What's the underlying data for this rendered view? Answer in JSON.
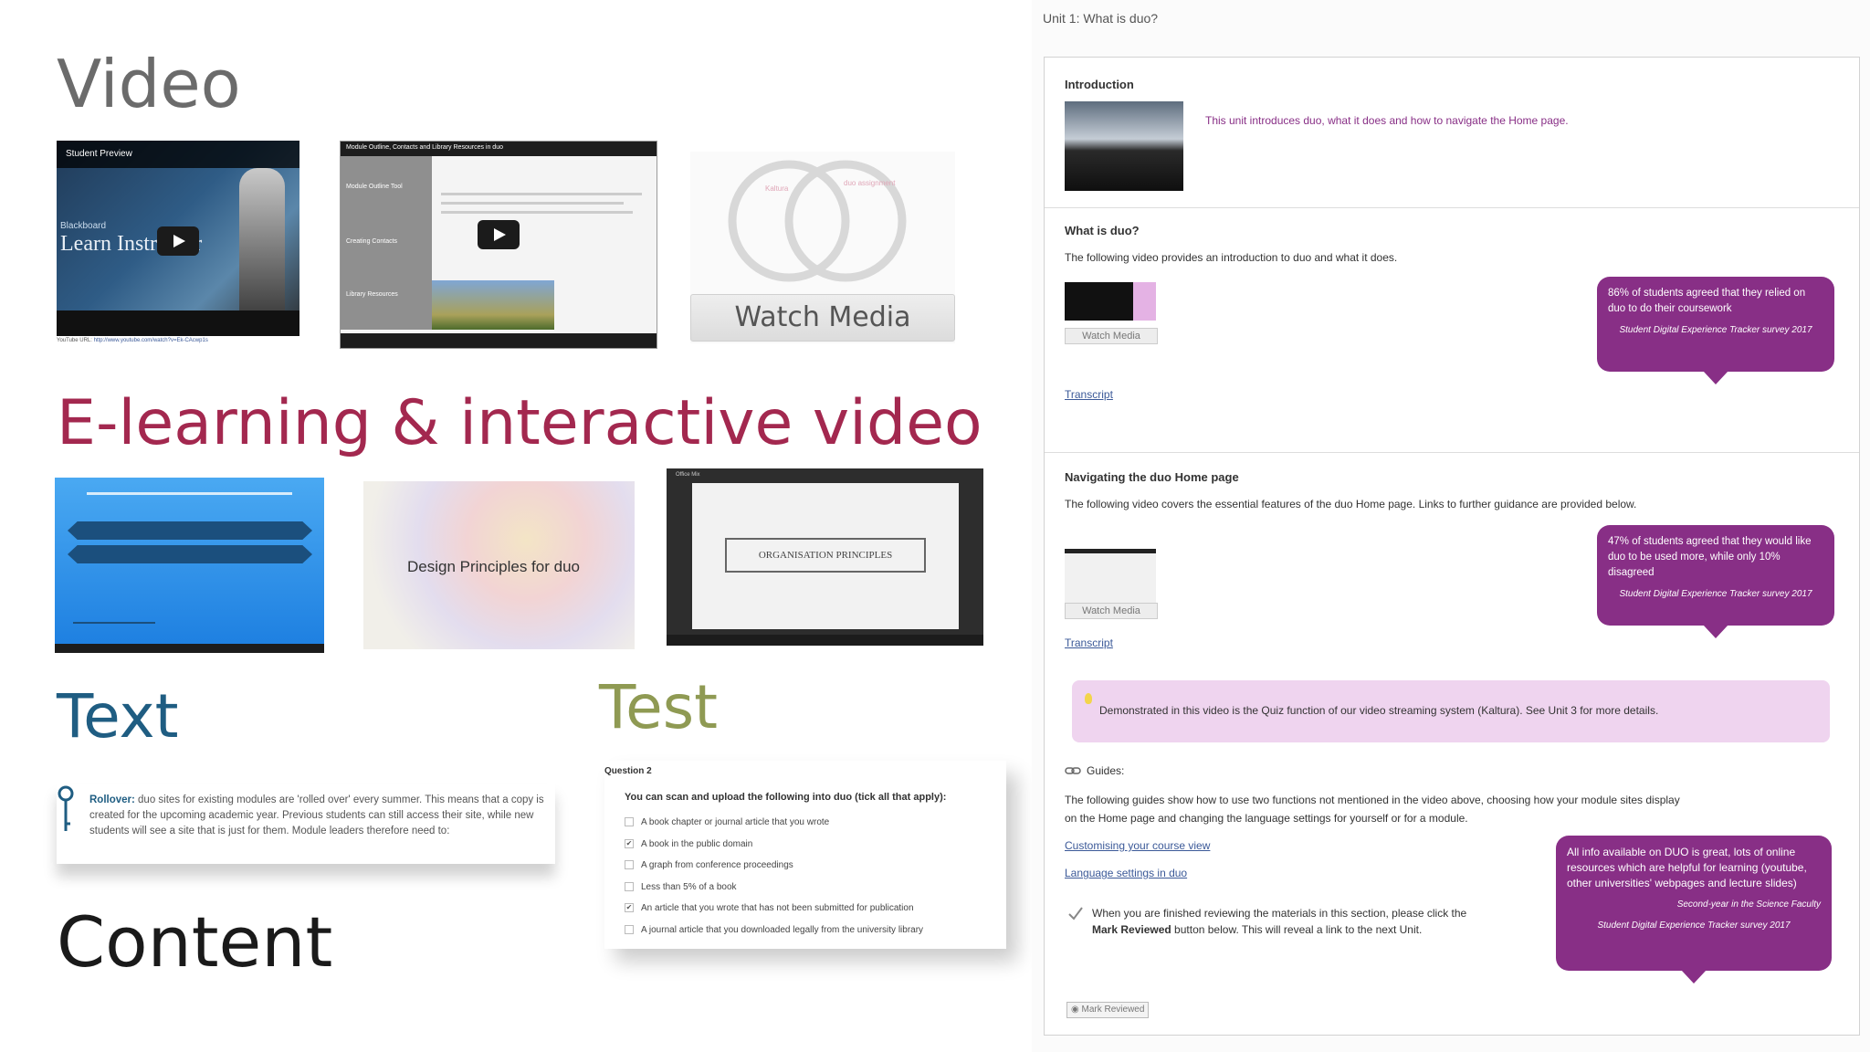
{
  "left": {
    "video_heading": "Video",
    "video_thumbs": {
      "student_preview": "Student Preview",
      "blackboard": "Blackboard",
      "learn_instructor": "Learn Instructor",
      "youtube_url_label": "YouTube URL:",
      "youtube_url": "http://www.youtube.com/watch?v=Ek-CAcwp1s",
      "module_tour_title": "Module Outline, Contacts and Library Resources in duo",
      "module_outline_tool": "Module Outline Tool",
      "creating_contacts": "Creating Contacts",
      "library_resources": "Library Resources",
      "watch_media": "Watch Media",
      "venn_left": "Kaltura",
      "venn_right": "duo assignment"
    },
    "elearning_heading": "E-learning & interactive video",
    "elearning_thumbs": {
      "design_principles": "Design Principles for duo",
      "organisation_principles": "ORGANISATION PRINCIPLES",
      "office_mix": "Office Mix"
    },
    "text_heading": "Text",
    "rollover_label": "Rollover:",
    "rollover_text": " duo sites for existing modules are 'rolled over' every summer. This means that a copy is created for the upcoming academic year. Previous students can still access their site, while new students will see a site that is just for them. Module leaders therefore need to:",
    "test_heading": "Test",
    "question": {
      "number": "Question 2",
      "prompt": "You can scan and upload the following into duo (tick all that apply):",
      "options": [
        {
          "text": "A book chapter or journal article that you wrote",
          "checked": false
        },
        {
          "text": "A book in the public domain",
          "checked": true
        },
        {
          "text": "A graph from conference proceedings",
          "checked": false
        },
        {
          "text": "Less than 5% of a book",
          "checked": false
        },
        {
          "text": "An article that you wrote that has not been submitted for publication",
          "checked": true
        },
        {
          "text": "A journal article that you downloaded legally from the university library",
          "checked": false
        }
      ]
    },
    "content_heading": "Content"
  },
  "right": {
    "unit_title": "Unit 1: What is duo?",
    "intro": {
      "title": "Introduction",
      "text": "This unit introduces duo, what it does and how to navigate the Home page."
    },
    "what_is_duo": {
      "title": "What is duo?",
      "text": "The following video provides an introduction to duo and what it does.",
      "watch": "Watch Media",
      "transcript": "Transcript",
      "bubble_text": "86% of students agreed that they relied on duo to do their coursework",
      "bubble_source": "Student Digital Experience Tracker survey 2017"
    },
    "navigating": {
      "title": "Navigating the duo Home page",
      "text": "The following video covers the essential features of the duo Home page. Links to further guidance are provided below.",
      "watch": "Watch Media",
      "transcript": "Transcript",
      "bubble_text": "47% of students agreed that they would like duo to be used more, while only 10% disagreed",
      "bubble_source": "Student Digital Experience Tracker survey 2017"
    },
    "note": "Demonstrated in this video is the Quiz function of our video streaming system (Kaltura). See Unit 3 for more details.",
    "guides": {
      "label": "Guides:",
      "text1": "The following guides show how to use two functions not mentioned in the video above, choosing how your module sites display",
      "text2": "on the Home page and changing the language settings for yourself or for a module.",
      "link1": "Customising your course view",
      "link2": "Language settings in duo"
    },
    "finish": {
      "line1": "When you are finished reviewing the materials in this section, please click the",
      "bold": "Mark Reviewed",
      "line2": " button below. This will reveal a link to the next Unit."
    },
    "bubble3": {
      "text": "All info available on DUO is great, lots of online resources which are helpful for learning (youtube, other universities' webpages and lecture slides)",
      "who": "Second-year in the Science Faculty",
      "source": "Student Digital Experience Tracker survey 2017"
    },
    "mark_reviewed": "Mark Reviewed"
  },
  "colors": {
    "video": "#6b6b6b",
    "elearning": "#a3284f",
    "text": "#1f5d82",
    "test": "#8f9a53",
    "content": "#1a1a1a",
    "bubble": "#882f86",
    "note_bg": "#efd4ef"
  }
}
